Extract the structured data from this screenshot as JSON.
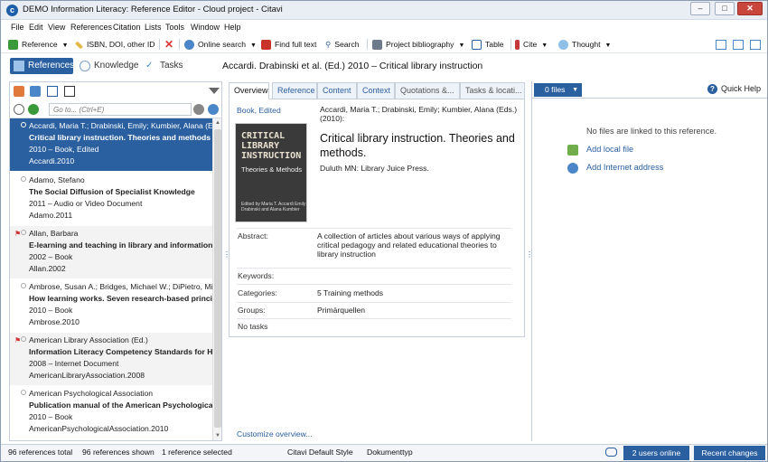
{
  "window": {
    "title": "DEMO Information Literacy: Reference Editor - Cloud project - Citavi",
    "app_icon": "citavi-icon"
  },
  "menu": [
    "File",
    "Edit",
    "View",
    "References",
    "Citation",
    "Lists",
    "Tools",
    "Window",
    "Help"
  ],
  "toolbar": {
    "reference": "Reference",
    "isbn": "ISBN, DOI, other ID",
    "online_search": "Online search",
    "find_full_text": "Find full text",
    "search": "Search",
    "project_bibliography": "Project bibliography",
    "table": "Table",
    "cite": "Cite",
    "thought": "Thought"
  },
  "nav": {
    "references": "References",
    "knowledge": "Knowledge",
    "tasks": "Tasks"
  },
  "reference_heading": "Accardi. Drabinski et al. (Ed.) 2010 – Critical library instruction",
  "quick_search_placeholder": "Go to... (Ctrl+E)",
  "references": [
    {
      "authors": "Accardi, Maria T.; Drabinski, Emily; Kumbier, Alana (Ed",
      "title": "Critical library instruction. Theories and methods",
      "info": "2010 – Book, Edited",
      "key": "Accardi.2010",
      "flag": false
    },
    {
      "authors": "Adamo, Stefano",
      "title": "The Social Diffusion of Specialist Knowledge",
      "info": "2011 – Audio or Video Document",
      "key": "Adamo.2011",
      "flag": false
    },
    {
      "authors": "Allan, Barbara",
      "title": "E-learning and teaching in library and information se",
      "info": "2002 – Book",
      "key": "Allan.2002",
      "flag": true
    },
    {
      "authors": "Ambrose, Susan A.; Bridges, Michael W.; DiPietro, Mic",
      "title": "How learning works. Seven research-based principle",
      "info": "2010 – Book",
      "key": "Ambrose.2010",
      "flag": false
    },
    {
      "authors": "American Library Association (Ed.)",
      "title": "Information Literacy Competency Standards for Hig",
      "info": "2008 – Internet Document",
      "key": "AmericanLibraryAssociation.2008",
      "flag": true
    },
    {
      "authors": "American Psychological Association",
      "title": "Publication manual of the American Psychological As",
      "info": "2010 – Book",
      "key": "AmericanPsychologicalAssociation.2010",
      "flag": false
    }
  ],
  "tabs": [
    "Overview",
    "Reference",
    "Content",
    "Context",
    "Quotations &...",
    "Tasks & locati..."
  ],
  "overview": {
    "ref_type": "Book, Edited",
    "authors": "Accardi, Maria T.; Drabinski, Emily; Kumbier, Alana (Eds.) (2010):",
    "title": "Critical library instruction. Theories and methods.",
    "publisher": "Duluth MN: Library Juice Press.",
    "cover_title": "CRITICAL LIBRARY INSTRUCTION",
    "cover_subtitle": "Theories & Methods",
    "cover_editors": "Edited by Maria T. Accardi Emily Drabinski and Alana Kumbier",
    "abstract_label": "Abstract:",
    "abstract": "A collection of articles about various ways of applying critical pedagogy and related educational theories to library instruction",
    "keywords_label": "Keywords:",
    "categories_label": "Categories:",
    "categories": "5 Training methods",
    "groups_label": "Groups:",
    "groups": "Primärquellen",
    "tasks": "No tasks",
    "customize": "Customize overview..."
  },
  "files": {
    "button": "0 files",
    "quick_help": "Quick Help",
    "no_files": "No files are linked to this reference.",
    "add_local": "Add local file",
    "add_internet": "Add Internet address"
  },
  "status": {
    "total": "96 references total",
    "shown": "96 references shown",
    "selected": "1 reference selected",
    "style": "Citavi Default Style",
    "doctype": "Dokumenttyp",
    "users": "2 users online",
    "recent": "Recent changes"
  },
  "colors": {
    "accent": "#2a5fa0",
    "close": "#c9463d",
    "flag": "#cc3333"
  }
}
